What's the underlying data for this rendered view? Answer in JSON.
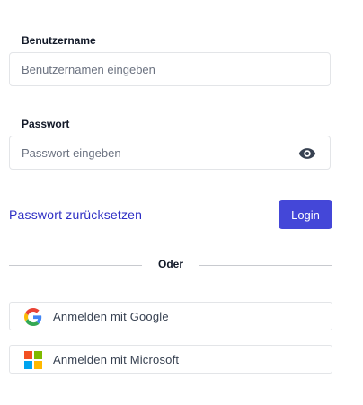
{
  "form": {
    "username_label": "Benutzername",
    "username_placeholder": "Benutzernamen eingeben",
    "password_label": "Passwort",
    "password_placeholder": "Passwort eingeben",
    "reset_link": "Passwort zurücksetzen",
    "login_label": "Login"
  },
  "divider": {
    "text": "Oder"
  },
  "social": {
    "google_label": "Anmelden mit Google",
    "microsoft_label": "Anmelden mit Microsoft"
  },
  "colors": {
    "primary": "#4447d8",
    "link": "#2d2ec4",
    "border": "#e3e5e8"
  },
  "icons": {
    "password_toggle": "eye-icon",
    "google": "google-logo-icon",
    "microsoft": "microsoft-logo-icon"
  }
}
